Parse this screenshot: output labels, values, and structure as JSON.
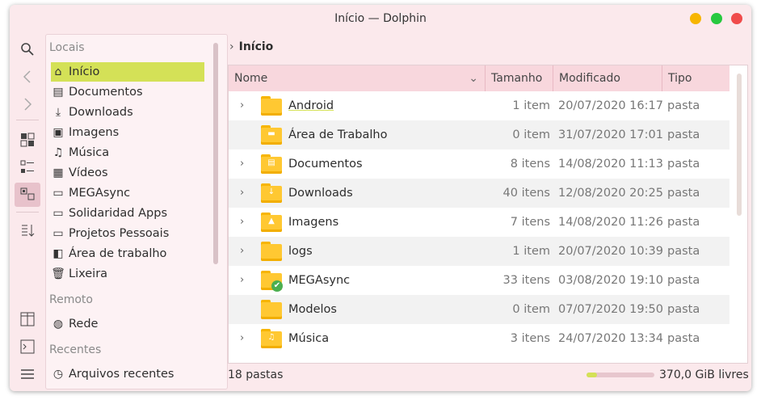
{
  "window": {
    "title": "Início — Dolphin",
    "controls": [
      {
        "name": "minimize",
        "color": "#f7b500"
      },
      {
        "name": "maximize",
        "color": "#27c93f"
      },
      {
        "name": "close",
        "color": "#f04b4b"
      }
    ]
  },
  "toolbar": {
    "buttons": [
      "search-icon",
      "back-icon",
      "forward-icon",
      "icons-view-icon",
      "compact-view-icon",
      "details-view-icon",
      "sort-icon",
      "split-icon",
      "terminal-icon",
      "menu-icon"
    ]
  },
  "places": {
    "sections": {
      "locais": "Locais",
      "remoto": "Remoto",
      "recentes": "Recentes"
    },
    "locais_items": [
      {
        "label": "Início",
        "icon": "home-icon",
        "selected": true
      },
      {
        "label": "Documentos",
        "icon": "document-icon"
      },
      {
        "label": "Downloads",
        "icon": "download-icon"
      },
      {
        "label": "Imagens",
        "icon": "image-icon"
      },
      {
        "label": "Música",
        "icon": "music-icon"
      },
      {
        "label": "Vídeos",
        "icon": "video-icon"
      },
      {
        "label": "MEGAsync",
        "icon": "folder-icon"
      },
      {
        "label": "Solidaridad Apps",
        "icon": "folder-icon"
      },
      {
        "label": "Projetos Pessoais",
        "icon": "folder-icon"
      },
      {
        "label": "Área de trabalho",
        "icon": "desktop-icon"
      },
      {
        "label": "Lixeira",
        "icon": "trash-icon"
      }
    ],
    "remoto_items": [
      {
        "label": "Rede",
        "icon": "network-icon"
      }
    ],
    "recentes_items": [
      {
        "label": "Arquivos recentes",
        "icon": "recent-icon"
      }
    ]
  },
  "breadcrumb": {
    "current": "Início"
  },
  "columns": {
    "name": "Nome",
    "size": "Tamanho",
    "modified": "Modificado",
    "type": "Tipo"
  },
  "files": [
    {
      "name": "Android",
      "size": "1 item",
      "modified": "20/07/2020 16:17",
      "type": "pasta",
      "expandable": true,
      "glyph": "",
      "underline": true
    },
    {
      "name": "Área de Trabalho",
      "size": "0 item",
      "modified": "31/07/2020 17:01",
      "type": "pasta",
      "expandable": false,
      "glyph": "▬"
    },
    {
      "name": "Documentos",
      "size": "8 itens",
      "modified": "14/08/2020 11:13",
      "type": "pasta",
      "expandable": true,
      "glyph": "▤"
    },
    {
      "name": "Downloads",
      "size": "40 itens",
      "modified": "12/08/2020 20:25",
      "type": "pasta",
      "expandable": true,
      "glyph": "↓"
    },
    {
      "name": "Imagens",
      "size": "7 itens",
      "modified": "14/08/2020 11:26",
      "type": "pasta",
      "expandable": true,
      "glyph": "▲"
    },
    {
      "name": "logs",
      "size": "1 item",
      "modified": "20/07/2020 10:39",
      "type": "pasta",
      "expandable": true,
      "glyph": ""
    },
    {
      "name": "MEGAsync",
      "size": "33 itens",
      "modified": "03/08/2020 19:10",
      "type": "pasta",
      "expandable": true,
      "glyph": "",
      "badge": "✔"
    },
    {
      "name": "Modelos",
      "size": "0 item",
      "modified": "07/07/2020 19:50",
      "type": "pasta",
      "expandable": false,
      "glyph": ""
    },
    {
      "name": "Música",
      "size": "3 itens",
      "modified": "24/07/2020 13:34",
      "type": "pasta",
      "expandable": true,
      "glyph": "♫"
    }
  ],
  "status": {
    "count": "18 pastas",
    "free": "370,0 GiB livres",
    "used_fraction": 0.15
  }
}
